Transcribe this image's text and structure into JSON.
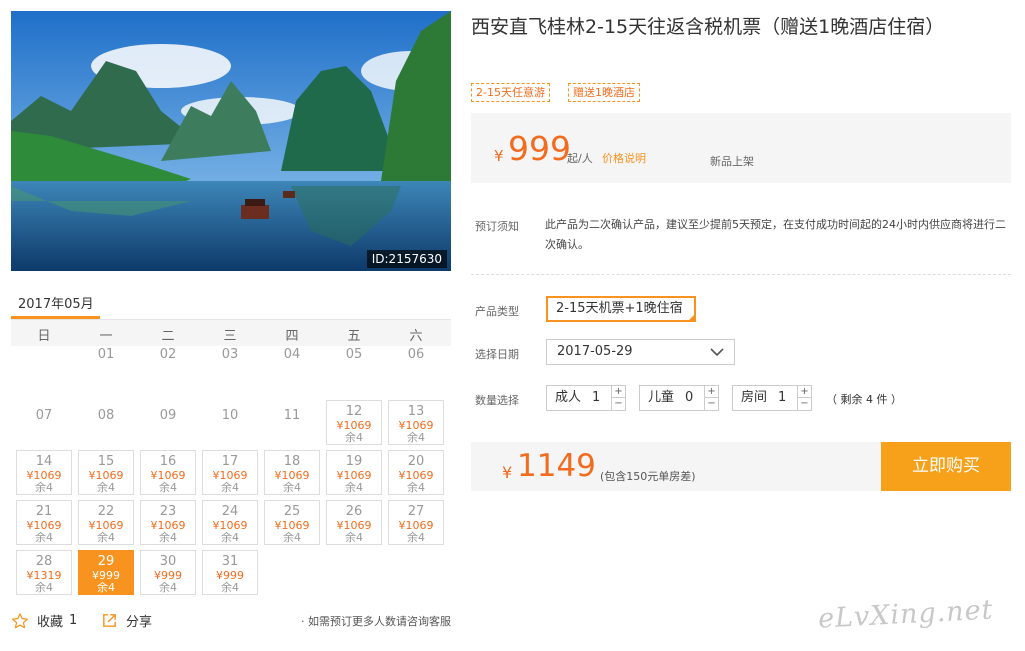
{
  "product": {
    "image_id": "ID:2157630",
    "title": "西安直飞桂林2-15天往返含税机票（赠送1晚酒店住宿）",
    "tags": [
      "2-15天任意游",
      "赠送1晚酒店"
    ]
  },
  "price": {
    "currency": "¥",
    "amount": "999",
    "unit": "起/人",
    "info_link": "价格说明",
    "status": "新品上架"
  },
  "booking_notice": {
    "label": "预订须知",
    "text": "此产品为二次确认产品，建议至少提前5天预定，在支付成功时间起的24小时内供应商将进行二次确认。"
  },
  "options": {
    "product_type_label": "产品类型",
    "product_type_value": "2-15天机票+1晚住宿",
    "date_label": "选择日期",
    "date_value": "2017-05-29",
    "quantity_label": "数量选择",
    "adult_label": "成人",
    "adult_value": "1",
    "child_label": "儿童",
    "child_value": "0",
    "room_label": "房间",
    "room_value": "1",
    "remaining": "（ 剩余 4 件 ）",
    "plus": "+",
    "minus": "−"
  },
  "total": {
    "currency": "¥",
    "amount": "1149",
    "note": "(包含150元单房差)",
    "buy_label": "立即购买"
  },
  "calendar": {
    "month": "2017年05月",
    "weekdays": [
      "日",
      "一",
      "二",
      "三",
      "四",
      "五",
      "六"
    ],
    "rows": [
      [
        null,
        {
          "d": "01"
        },
        {
          "d": "02"
        },
        {
          "d": "03"
        },
        {
          "d": "04"
        },
        {
          "d": "05"
        },
        {
          "d": "06"
        }
      ],
      [
        {
          "d": "07"
        },
        {
          "d": "08"
        },
        {
          "d": "09"
        },
        {
          "d": "10"
        },
        {
          "d": "11"
        },
        {
          "d": "12",
          "p": "¥1069",
          "r": "余4"
        },
        {
          "d": "13",
          "p": "¥1069",
          "r": "余4"
        }
      ],
      [
        {
          "d": "14",
          "p": "¥1069",
          "r": "余4"
        },
        {
          "d": "15",
          "p": "¥1069",
          "r": "余4"
        },
        {
          "d": "16",
          "p": "¥1069",
          "r": "余4"
        },
        {
          "d": "17",
          "p": "¥1069",
          "r": "余4"
        },
        {
          "d": "18",
          "p": "¥1069",
          "r": "余4"
        },
        {
          "d": "19",
          "p": "¥1069",
          "r": "余4"
        },
        {
          "d": "20",
          "p": "¥1069",
          "r": "余4"
        }
      ],
      [
        {
          "d": "21",
          "p": "¥1069",
          "r": "余4"
        },
        {
          "d": "22",
          "p": "¥1069",
          "r": "余4"
        },
        {
          "d": "23",
          "p": "¥1069",
          "r": "余4"
        },
        {
          "d": "24",
          "p": "¥1069",
          "r": "余4"
        },
        {
          "d": "25",
          "p": "¥1069",
          "r": "余4"
        },
        {
          "d": "26",
          "p": "¥1069",
          "r": "余4"
        },
        {
          "d": "27",
          "p": "¥1069",
          "r": "余4"
        }
      ],
      [
        {
          "d": "28",
          "p": "¥1319",
          "r": "余4"
        },
        {
          "d": "29",
          "p": "¥999",
          "r": "余4",
          "selected": true
        },
        {
          "d": "30",
          "p": "¥999",
          "r": "余4"
        },
        {
          "d": "31",
          "p": "¥999",
          "r": "余4"
        },
        null,
        null,
        null
      ]
    ]
  },
  "actions": {
    "favorite_label": "收藏",
    "favorite_count": "1",
    "share_label": "分享",
    "contact_note": "· 如需预订更多人数请咨询客服"
  },
  "watermark": "eLvXing.net",
  "colors": {
    "accent": "#f7931e",
    "price": "#f26c1f",
    "buy_button": "#f7a019"
  }
}
